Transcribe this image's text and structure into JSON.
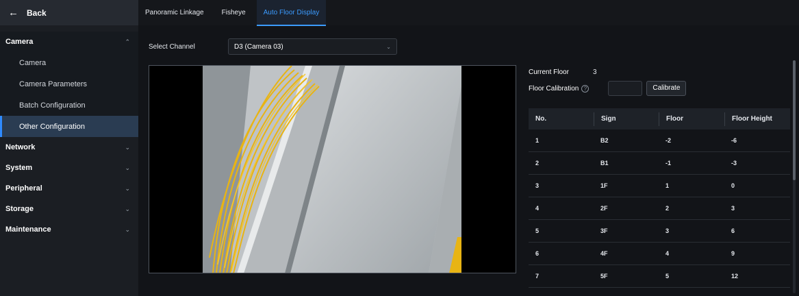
{
  "back": {
    "label": "Back"
  },
  "sidebar": {
    "camera_group": {
      "label": "Camera",
      "items": [
        {
          "label": "Camera"
        },
        {
          "label": "Camera Parameters"
        },
        {
          "label": "Batch Configuration"
        },
        {
          "label": "Other Configuration",
          "active": true
        }
      ]
    },
    "groups": [
      {
        "label": "Network"
      },
      {
        "label": "System"
      },
      {
        "label": "Peripheral"
      },
      {
        "label": "Storage"
      },
      {
        "label": "Maintenance"
      }
    ]
  },
  "tabs": [
    {
      "label": "Panoramic Linkage"
    },
    {
      "label": "Fisheye"
    },
    {
      "label": "Auto Floor Display",
      "active": true
    }
  ],
  "channel": {
    "label": "Select Channel",
    "value": "D3 (Camera 03)"
  },
  "current_floor": {
    "label": "Current Floor",
    "value": "3"
  },
  "calibration": {
    "label": "Floor Calibration",
    "input_value": "",
    "button_label": "Calibrate"
  },
  "table": {
    "headers": [
      "No.",
      "Sign",
      "Floor",
      "Floor Height"
    ],
    "rows": [
      [
        "1",
        "B2",
        "-2",
        "-6"
      ],
      [
        "2",
        "B1",
        "-1",
        "-3"
      ],
      [
        "3",
        "1F",
        "1",
        "0"
      ],
      [
        "4",
        "2F",
        "2",
        "3"
      ],
      [
        "5",
        "3F",
        "3",
        "6"
      ],
      [
        "6",
        "4F",
        "4",
        "9"
      ],
      [
        "7",
        "5F",
        "5",
        "12"
      ]
    ]
  },
  "colors": {
    "accent": "#3b9bff",
    "sidebar_bg": "#1b1e23",
    "main_bg": "#121418",
    "active_item_bg": "#2a3c52"
  }
}
